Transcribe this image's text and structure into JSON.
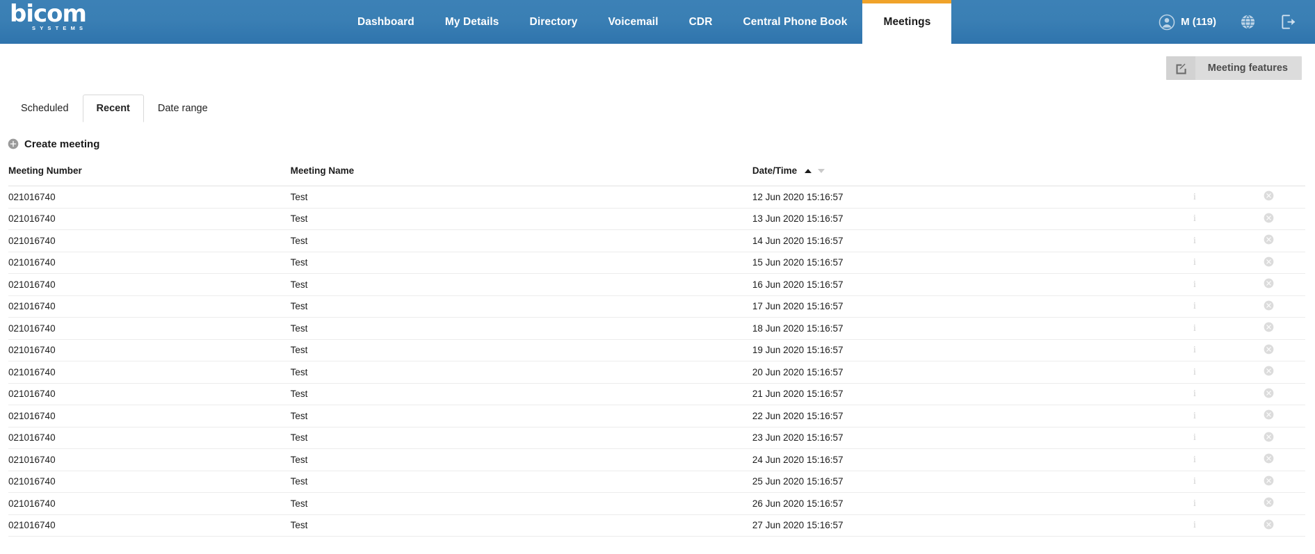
{
  "brand": {
    "logo_word": "bicom",
    "logo_sub": "SYSTEMS",
    "accent_orange": "#f0a32a",
    "header_blue": "#3a7fb4"
  },
  "header": {
    "nav": [
      {
        "label": "Dashboard",
        "active": false
      },
      {
        "label": "My Details",
        "active": false
      },
      {
        "label": "Directory",
        "active": false
      },
      {
        "label": "Voicemail",
        "active": false
      },
      {
        "label": "CDR",
        "active": false
      },
      {
        "label": "Central Phone Book",
        "active": false
      },
      {
        "label": "Meetings",
        "active": true
      }
    ],
    "user": {
      "name": "M (119)",
      "avatar_icon": "user-circle-icon",
      "language_icon": "globe-icon",
      "logout_icon": "logout-icon"
    }
  },
  "toolbar": {
    "meeting_features_label": "Meeting features",
    "meeting_features_icon": "edit-square-icon"
  },
  "subtabs": [
    {
      "label": "Scheduled",
      "active": false
    },
    {
      "label": "Recent",
      "active": true
    },
    {
      "label": "Date range",
      "active": false
    }
  ],
  "create": {
    "label": "Create meeting",
    "icon": "plus-circle-icon"
  },
  "table": {
    "columns": [
      {
        "label": "Meeting Number"
      },
      {
        "label": "Meeting Name"
      },
      {
        "label": "Date/Time",
        "sorted": "asc"
      }
    ],
    "sort": {
      "active_direction": "asc",
      "up_color": "#1b1b1b",
      "down_color": "#c9c9c9"
    },
    "row_icons": {
      "info": "info-icon",
      "delete": "delete-circle-icon"
    },
    "rows": [
      {
        "number": "021016740",
        "name": "Test",
        "datetime": "12 Jun 2020 15:16:57"
      },
      {
        "number": "021016740",
        "name": "Test",
        "datetime": "13 Jun 2020 15:16:57"
      },
      {
        "number": "021016740",
        "name": "Test",
        "datetime": "14 Jun 2020 15:16:57"
      },
      {
        "number": "021016740",
        "name": "Test",
        "datetime": "15 Jun 2020 15:16:57"
      },
      {
        "number": "021016740",
        "name": "Test",
        "datetime": "16 Jun 2020 15:16:57"
      },
      {
        "number": "021016740",
        "name": "Test",
        "datetime": "17 Jun 2020 15:16:57"
      },
      {
        "number": "021016740",
        "name": "Test",
        "datetime": "18 Jun 2020 15:16:57"
      },
      {
        "number": "021016740",
        "name": "Test",
        "datetime": "19 Jun 2020 15:16:57"
      },
      {
        "number": "021016740",
        "name": "Test",
        "datetime": "20 Jun 2020 15:16:57"
      },
      {
        "number": "021016740",
        "name": "Test",
        "datetime": "21 Jun 2020 15:16:57"
      },
      {
        "number": "021016740",
        "name": "Test",
        "datetime": "22 Jun 2020 15:16:57"
      },
      {
        "number": "021016740",
        "name": "Test",
        "datetime": "23 Jun 2020 15:16:57"
      },
      {
        "number": "021016740",
        "name": "Test",
        "datetime": "24 Jun 2020 15:16:57"
      },
      {
        "number": "021016740",
        "name": "Test",
        "datetime": "25 Jun 2020 15:16:57"
      },
      {
        "number": "021016740",
        "name": "Test",
        "datetime": "26 Jun 2020 15:16:57"
      },
      {
        "number": "021016740",
        "name": "Test",
        "datetime": "27 Jun 2020 15:16:57"
      }
    ]
  }
}
